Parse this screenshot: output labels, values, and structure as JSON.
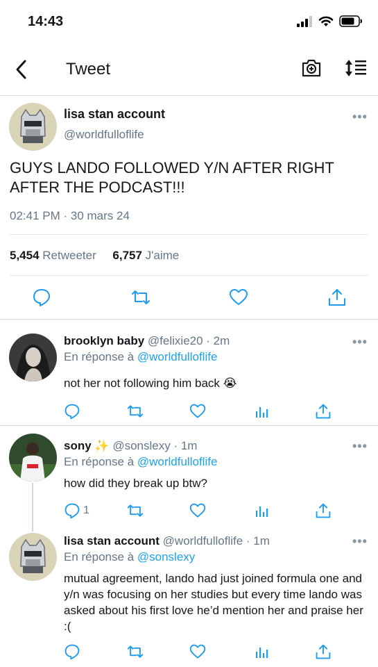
{
  "status_bar": {
    "time": "14:43"
  },
  "nav": {
    "title": "Tweet"
  },
  "main_tweet": {
    "name": "lisa stan account",
    "handle": "@worldfulloflife",
    "text": "GUYS LANDO FOLLOWED Y/N AFTER RIGHT AFTER THE PODCAST!!!",
    "timestamp": "02:41 PM · 30 mars 24",
    "retweets_count": "5,454",
    "retweets_label": "Retweeter",
    "likes_count": "6,757",
    "likes_label": "J'aime"
  },
  "replies": [
    {
      "name": "brooklyn baby",
      "handle": "@felixie20 · 2m",
      "reply_prefix": "En réponse à",
      "reply_to": "@worldfulloflife",
      "text": "not her not following him back 😭",
      "reply_count": ""
    },
    {
      "name": "sony",
      "sparkle": "✨",
      "handle": "@sonslexy · 1m",
      "reply_prefix": "En réponse à",
      "reply_to": "@worldfulloflife",
      "text": "how did they break up btw?",
      "reply_count": "1"
    },
    {
      "name": "lisa stan account",
      "handle": "@worldfulloflife · 1m",
      "reply_prefix": "En réponse à",
      "reply_to": "@sonslexy",
      "text": "mutual agreement, lando had just joined formula one and y/n was focusing on her studies but every time lando was asked about his first love he’d mention her and praise her :(",
      "reply_count": ""
    }
  ],
  "colors": {
    "accent": "#1da1f2",
    "muted": "#657786",
    "icon": "#1d9bf0"
  }
}
